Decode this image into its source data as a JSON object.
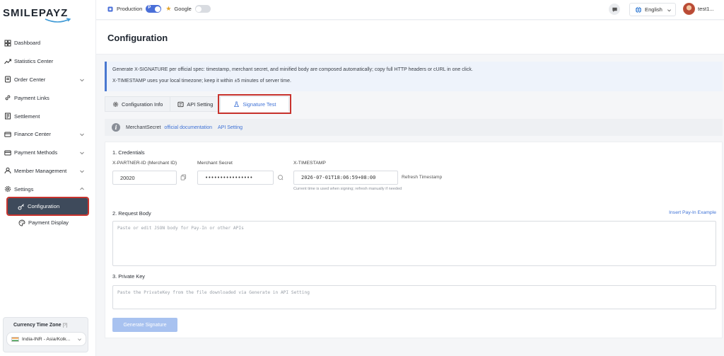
{
  "brand": {
    "name": "SMILEPAYZ"
  },
  "sidebar": {
    "items": [
      {
        "label": "Dashboard",
        "icon": "dashboard-icon",
        "expandable": false
      },
      {
        "label": "Statistics Center",
        "icon": "trend-icon",
        "expandable": false
      },
      {
        "label": "Order Center",
        "icon": "order-icon",
        "expandable": true
      },
      {
        "label": "Payment Links",
        "icon": "link-icon",
        "expandable": false
      },
      {
        "label": "Settlement",
        "icon": "settlement-icon",
        "expandable": false
      },
      {
        "label": "Finance Center",
        "icon": "finance-icon",
        "expandable": true
      },
      {
        "label": "Payment Methods",
        "icon": "card-icon",
        "expandable": true
      },
      {
        "label": "Member Management",
        "icon": "user-icon",
        "expandable": true
      },
      {
        "label": "Settings",
        "icon": "gear-icon",
        "expandable": true
      }
    ],
    "sub_items": [
      {
        "label": "Configuration",
        "icon": "key-icon",
        "active": true
      },
      {
        "label": "Payment Display",
        "icon": "palette-icon",
        "active": false
      }
    ],
    "timezone": {
      "title": "Currency Time Zone",
      "hint": "[?]",
      "value": "India-INR - Asia/Kolk..."
    }
  },
  "topbar": {
    "env_production": "Production",
    "env_toggle_text": "P",
    "env_google": "Google",
    "language": "English",
    "user": "test1..."
  },
  "page": {
    "title": "Configuration",
    "info_line1": "Generate X-SIGNATURE per official spec: timestamp, merchant secret, and minified body are composed automatically; copy full HTTP headers or cURL in one click.",
    "info_line2": "X-TIMESTAMP uses your local timezone; keep it within ±5 minutes of server time.",
    "tabs": [
      {
        "label": "Configuration Info",
        "icon": "config-icon",
        "active": false
      },
      {
        "label": "API Setting",
        "icon": "api-icon",
        "active": false
      },
      {
        "label": "Signature Test",
        "icon": "flask-icon",
        "active": true
      }
    ],
    "note": {
      "text": "MerchantSecret",
      "link1": "official documentation",
      "link2": "API Setting"
    },
    "credentials": {
      "title": "1. Credentials",
      "partner_label": "X-PARTNER-ID (Merchant ID)",
      "partner_value": "20020",
      "secret_label": "Merchant Secret",
      "secret_value": "••••••••••••••••",
      "timestamp_label": "X-TIMESTAMP",
      "timestamp_value": "2026-07-01T18:06:59+08:00",
      "refresh_label": "Refresh Timestamp",
      "timestamp_hint": "Current time is used when signing; refresh manually if needed"
    },
    "body": {
      "title": "2. Request Body",
      "example_link": "Insert Pay-In Example",
      "placeholder": "Paste or edit JSON body for Pay-In or other APIs"
    },
    "private_key": {
      "title": "3. Private Key",
      "placeholder": "Paste the PrivateKey from the file downloaded via Generate in API Setting"
    },
    "generate_label": "Generate Signature"
  },
  "colors": {
    "accent": "#3f72d6",
    "active_nav_bg": "#3e4a5b",
    "highlight_border": "#c8332d",
    "button_disabled": "#a8c2f0"
  }
}
